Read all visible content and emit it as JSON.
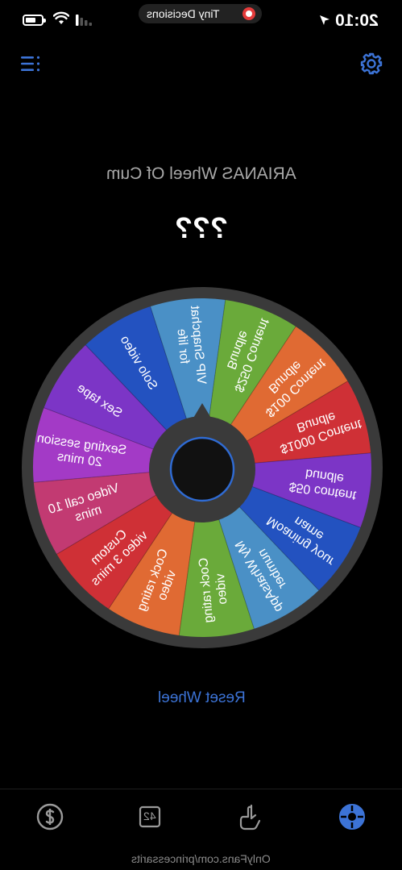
{
  "status_bar": {
    "time": "20:10",
    "app_name": "Tiny Decisions"
  },
  "header": {
    "menu_icon": "list-icon",
    "settings_icon": "gear-icon"
  },
  "wheel": {
    "title": "ARIANAS Wheel Of Cum",
    "result": "???",
    "segments": [
      {
        "label": "VIP Snapchat\nfor life",
        "color": "#4a90c6"
      },
      {
        "label": "$250 Content\nBundle",
        "color": "#6aaa3a"
      },
      {
        "label": "$100 Content\nBundle",
        "color": "#e06a33"
      },
      {
        "label": "$1000 Content\nBundle",
        "color": "#cf3036"
      },
      {
        "label": "$50 content\nbundle",
        "color": "#7c35c6"
      },
      {
        "label": "Moaning your\nname",
        "color": "#2352c0"
      },
      {
        "label": "My WhatsApp\nnumber",
        "color": "#4a90c6"
      },
      {
        "label": "Cock rating\nvideo",
        "color": "#6aaa3a"
      },
      {
        "label": "Cock rating\nvideo",
        "color": "#e06a33"
      },
      {
        "label": "Custom\nvideo 3 mins",
        "color": "#cf3036"
      },
      {
        "label": "Video call 10\nmins",
        "color": "#c23a72"
      },
      {
        "label": "Sexting session\n20 mins",
        "color": "#a33ac6"
      },
      {
        "label": "Sex tape",
        "color": "#7c35c6"
      },
      {
        "label": "Solo video",
        "color": "#2352c0"
      }
    ]
  },
  "actions": {
    "reset_label": "Reset Wheel"
  },
  "tab_bar": {
    "tabs": [
      {
        "icon": "dollar-coin-icon",
        "active": false
      },
      {
        "icon": "dice-icon",
        "label": "42",
        "active": false
      },
      {
        "icon": "hand-tap-icon",
        "active": false
      },
      {
        "icon": "wheel-icon",
        "active": true
      }
    ]
  },
  "watermark": "OnlyFans.com/princessarits",
  "colors": {
    "accent": "#3c73d6",
    "background": "#000000"
  }
}
